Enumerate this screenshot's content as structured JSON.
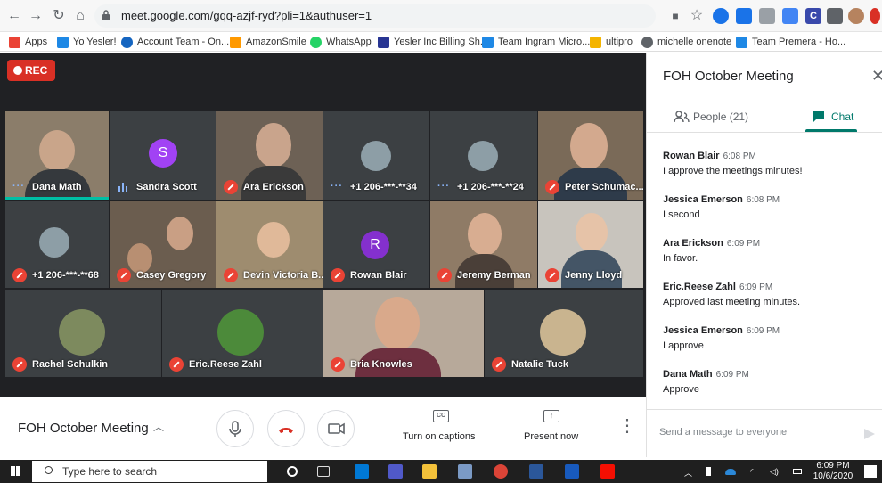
{
  "browser": {
    "url": "meet.google.com/gqq-azjf-ryd?pli=1&authuser=1",
    "bookmarks": [
      "Apps",
      "Yo Yesler!",
      "Account Team - On...",
      "AmazonSmile",
      "WhatsApp",
      "Yesler Inc Billing Sh...",
      "Team Ingram Micro...",
      "ultipro",
      "michelle onenote",
      "Team Premera - Ho..."
    ]
  },
  "meeting": {
    "rec_label": "REC",
    "title": "FOH October Meeting",
    "participants": [
      {
        "name": "Dana Math",
        "kind": "video"
      },
      {
        "name": "Sandra Scott",
        "kind": "avatar",
        "initial": "S",
        "color": "#a142f4"
      },
      {
        "name": "Ara Erickson",
        "kind": "video"
      },
      {
        "name": "+1 206-***-**34",
        "kind": "phone"
      },
      {
        "name": "+1 206-***-**24",
        "kind": "phone"
      },
      {
        "name": "Peter Schumac...",
        "kind": "video"
      },
      {
        "name": "+1 206-***-**68",
        "kind": "phone"
      },
      {
        "name": "Casey Gregory",
        "kind": "video"
      },
      {
        "name": "Devin Victoria B...",
        "kind": "video"
      },
      {
        "name": "Rowan Blair",
        "kind": "avatar",
        "initial": "R",
        "color": "#8430ce"
      },
      {
        "name": "Jeremy Berman",
        "kind": "video"
      },
      {
        "name": "Jenny Lloyd",
        "kind": "video"
      },
      {
        "name": "Rachel Schulkin",
        "kind": "photo"
      },
      {
        "name": "Eric.Reese Zahl",
        "kind": "photo"
      },
      {
        "name": "Bria Knowles",
        "kind": "video"
      },
      {
        "name": "Natalie Tuck",
        "kind": "photo"
      }
    ]
  },
  "controls": {
    "captions_label": "Turn on captions",
    "captions_icon_text": "CC",
    "present_label": "Present now"
  },
  "panel": {
    "title": "FOH October Meeting",
    "people_tab": "People (21)",
    "chat_tab": "Chat",
    "messages": [
      {
        "sender": "Rowan Blair",
        "time": "6:08 PM",
        "text": "I approve the meetings minutes!"
      },
      {
        "sender": "Jessica Emerson",
        "time": "6:08 PM",
        "text": "I second"
      },
      {
        "sender": "Ara Erickson",
        "time": "6:09 PM",
        "text": "In favor."
      },
      {
        "sender": "Eric.Reese Zahl",
        "time": "6:09 PM",
        "text": "Approved last meeting minutes."
      },
      {
        "sender": "Jessica Emerson",
        "time": "6:09 PM",
        "text": "I approve"
      },
      {
        "sender": "Dana Math",
        "time": "6:09 PM",
        "text": "Approve"
      }
    ],
    "send_placeholder": "Send a message to everyone"
  },
  "taskbar": {
    "search_placeholder": "Type here to search",
    "time": "6:09 PM",
    "date": "10/6/2020"
  },
  "colors": {
    "accent": "#00796b",
    "rec": "#d93025",
    "mic_off": "#ea4335",
    "hangup": "#d93025"
  }
}
